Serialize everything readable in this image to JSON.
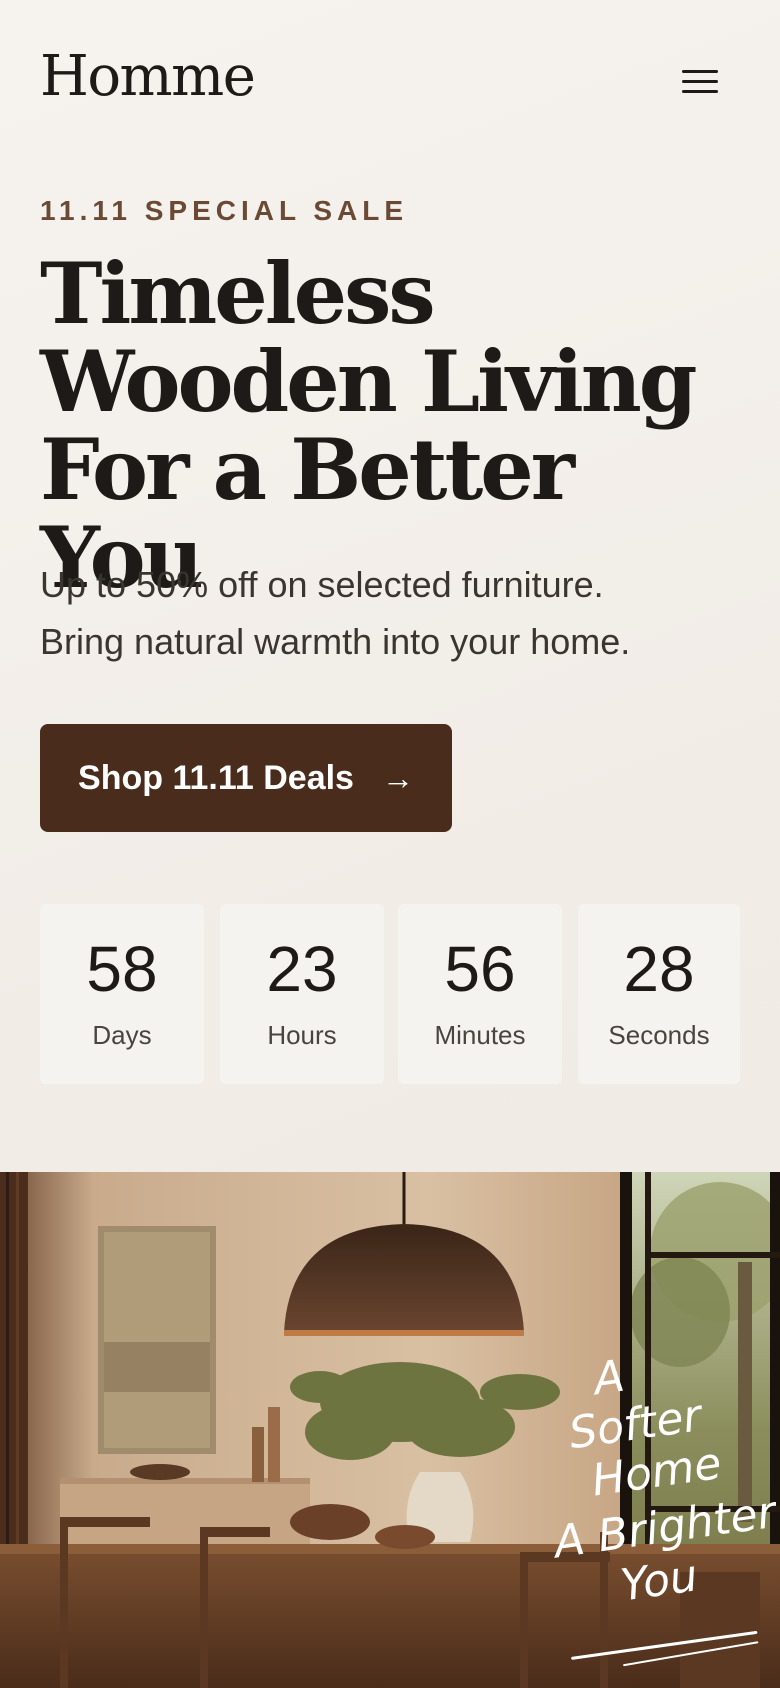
{
  "header": {
    "logo": "Homme",
    "menu_icon": "hamburger-menu-icon"
  },
  "hero": {
    "eyebrow": "11.11 SPECIAL SALE",
    "headline": [
      "Timeless",
      "Wooden Living",
      "For a Better You"
    ],
    "subtext": [
      "Up to 50% off on selected furniture.",
      "Bring natural warmth into your home."
    ],
    "cta_label": "Shop 11.11 Deals",
    "cta_icon": "arrow-right-icon"
  },
  "countdown": [
    {
      "value": "58",
      "label": "Days"
    },
    {
      "value": "23",
      "label": "Hours"
    },
    {
      "value": "56",
      "label": "Minutes"
    },
    {
      "value": "28",
      "label": "Seconds"
    }
  ],
  "image_overlay": {
    "lines": [
      "A",
      "Softer",
      "Home",
      "A Brighter",
      "You"
    ]
  },
  "colors": {
    "accent": "#4a2c1d",
    "eyebrow": "#6b4a35",
    "text": "#1d1a17",
    "background": "#f3efea"
  }
}
